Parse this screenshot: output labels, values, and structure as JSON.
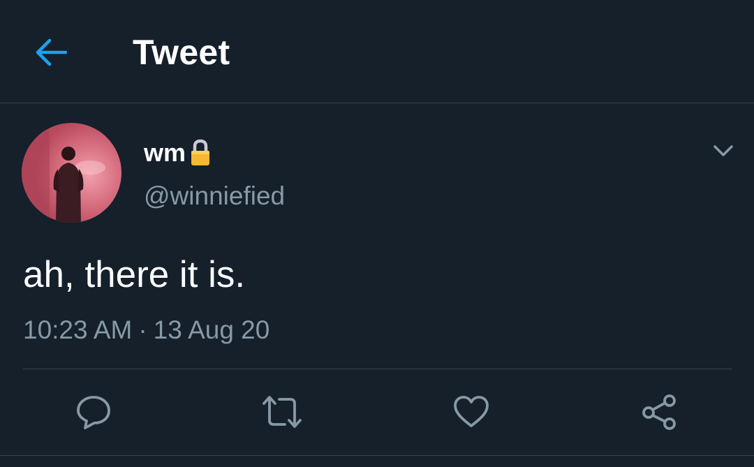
{
  "header": {
    "title": "Tweet",
    "back_icon": "arrow-left-icon"
  },
  "tweet": {
    "display_name": "wm",
    "lock_icon": "lock-icon",
    "handle": "@winniefied",
    "text": "ah, there it is.",
    "time": "10:23 AM",
    "separator": "·",
    "date": "13 Aug 20"
  },
  "actions": [
    {
      "name": "reply",
      "icon": "reply-icon"
    },
    {
      "name": "retweet",
      "icon": "retweet-icon"
    },
    {
      "name": "like",
      "icon": "heart-icon"
    },
    {
      "name": "share",
      "icon": "share-icon"
    }
  ],
  "colors": {
    "background": "#15202b",
    "accent": "#1da1f2",
    "secondary_text": "#8899a6",
    "border": "#38444d"
  }
}
